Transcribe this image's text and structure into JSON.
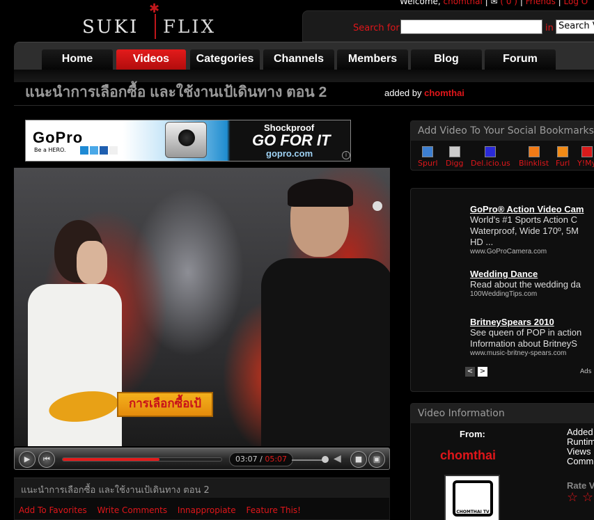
{
  "header": {
    "welcome": "Welcome,",
    "username": "chomthai",
    "messages_label": "( 0 )",
    "friends_label": "Friends",
    "logout_label": "Log O",
    "logo_left": "SUKI",
    "logo_right": "FLIX"
  },
  "search": {
    "label": "Search for",
    "value": "",
    "in_label": "in",
    "scope": "Search Vi"
  },
  "nav": {
    "items": [
      {
        "label": "Home",
        "active": false
      },
      {
        "label": "Videos",
        "active": true
      },
      {
        "label": "Categories",
        "active": false
      },
      {
        "label": "Channels",
        "active": false
      },
      {
        "label": "Members",
        "active": false
      },
      {
        "label": "Blog",
        "active": false
      },
      {
        "label": "Forum",
        "active": false
      }
    ]
  },
  "video_page": {
    "title": "แนะนำการเลือกซื้อ และใช้งานเป้เดินทาง ตอน 2",
    "added_by_label": "added by",
    "added_by_user": "chomthai"
  },
  "banner_ad": {
    "brand": "GoPro",
    "tagline": "Be a HERO.",
    "shockproof": "Shockproof",
    "headline": "GO FOR IT",
    "url": "gopro.com",
    "info": "i",
    "colors": [
      "#1e8ad4",
      "#4aa8e8",
      "#1f5fb0",
      "#f0f0f0"
    ]
  },
  "video": {
    "caption": "การเลือกซื้อเป้",
    "current_time": "03:07",
    "separator": " / ",
    "total_time": "05:07",
    "progress_fraction": 0.61,
    "volume_fraction": 0.85
  },
  "below_video": {
    "title": "แนะนำการเลือกซื้อ และใช้งานเป้เดินทาง ตอน 2",
    "actions": [
      "Add To Favorites",
      "Write Comments",
      "Innappropiate",
      "Feature This!"
    ]
  },
  "bookmarks": {
    "heading": "Add Video To Your Social Bookmarks",
    "items": [
      {
        "label": "Spurl",
        "icon": "spurl-icon",
        "color": "#3d7fd1"
      },
      {
        "label": "Digg",
        "icon": "digg-icon",
        "color": "#cccccc"
      },
      {
        "label": "Del.icio.us",
        "icon": "delicious-icon",
        "color": "#2a2ad8"
      },
      {
        "label": "Blinklist",
        "icon": "blinklist-icon",
        "color": "#f07a16"
      },
      {
        "label": "Furl",
        "icon": "furl-icon",
        "color": "#f08a16"
      },
      {
        "label": "Y!My",
        "icon": "yahoo-icon",
        "color": "#d81b1b"
      }
    ]
  },
  "text_ads": {
    "items": [
      {
        "title": "GoPro® Action Video Cam",
        "desc": [
          "World's #1 Sports Action C",
          "Waterproof, Wide 170º, 5M",
          "HD ..."
        ],
        "url": "www.GoProCamera.com"
      },
      {
        "title": "Wedding Dance",
        "desc": [
          "Read about the wedding da"
        ],
        "url": "100WeddingTips.com"
      },
      {
        "title": "BritneySpears 2010",
        "desc": [
          "See queen of POP in action",
          "Information about BritneyS"
        ],
        "url": "www.music-britney-spears.com"
      }
    ],
    "prev": "<",
    "next": ">",
    "ads_by": "Ads"
  },
  "video_info": {
    "heading": "Video Information",
    "from_label": "From:",
    "user": "chomthai",
    "avatar_text": "CHOMTHAI TV",
    "meta": [
      "Added",
      "Runtim",
      "Views",
      "Comm"
    ],
    "rate_label": "Rate V",
    "stars": "☆ ☆"
  }
}
